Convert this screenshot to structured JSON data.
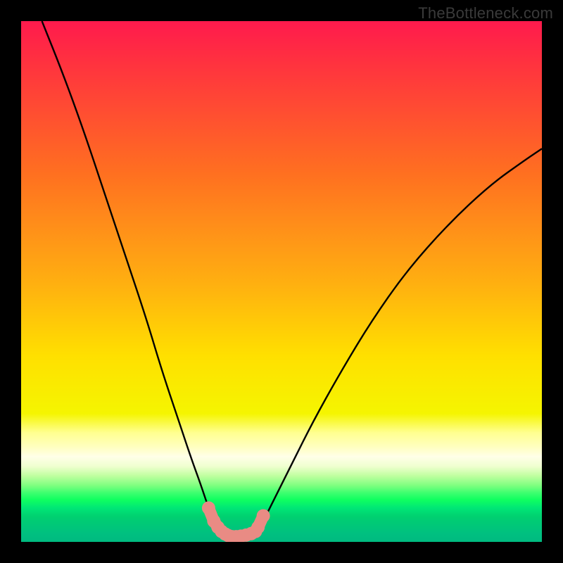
{
  "watermark": "TheBottleneck.com",
  "colors": {
    "frame": "#000000",
    "curve_stroke": "#000000",
    "marker_fill": "#e98b84",
    "marker_stroke": "#e98b84",
    "gradient_top": "#ff1a4d",
    "gradient_bottom": "#00ba80"
  },
  "chart_data": {
    "type": "line",
    "title": "",
    "xlabel": "",
    "ylabel": "",
    "xlim": [
      0,
      1
    ],
    "ylim": [
      0,
      1
    ],
    "note": "No numeric axes/ticks are shown; x/y are normalized 0–1 within the plot area. Background color encodes bottleneck severity (red=high, green=low). Curves drop to y≈0 (best) in the valley.",
    "series": [
      {
        "name": "left-curve",
        "x": [
          0.04,
          0.08,
          0.12,
          0.16,
          0.2,
          0.24,
          0.27,
          0.3,
          0.325,
          0.345,
          0.36,
          0.37,
          0.378,
          0.385
        ],
        "y": [
          1.0,
          0.9,
          0.79,
          0.67,
          0.55,
          0.43,
          0.33,
          0.24,
          0.165,
          0.11,
          0.065,
          0.04,
          0.025,
          0.018
        ]
      },
      {
        "name": "right-curve",
        "x": [
          0.455,
          0.47,
          0.49,
          0.52,
          0.56,
          0.61,
          0.67,
          0.74,
          0.82,
          0.9,
          0.97,
          1.0
        ],
        "y": [
          0.02,
          0.05,
          0.09,
          0.15,
          0.23,
          0.32,
          0.42,
          0.52,
          0.61,
          0.685,
          0.735,
          0.755
        ]
      },
      {
        "name": "valley-markers",
        "type": "scatter",
        "x": [
          0.36,
          0.37,
          0.378,
          0.385,
          0.392,
          0.398,
          0.405,
          0.413,
          0.422,
          0.432,
          0.442,
          0.45,
          0.455,
          0.465
        ],
        "y": [
          0.065,
          0.04,
          0.028,
          0.02,
          0.015,
          0.012,
          0.01,
          0.01,
          0.011,
          0.013,
          0.016,
          0.02,
          0.028,
          0.05
        ]
      }
    ]
  }
}
